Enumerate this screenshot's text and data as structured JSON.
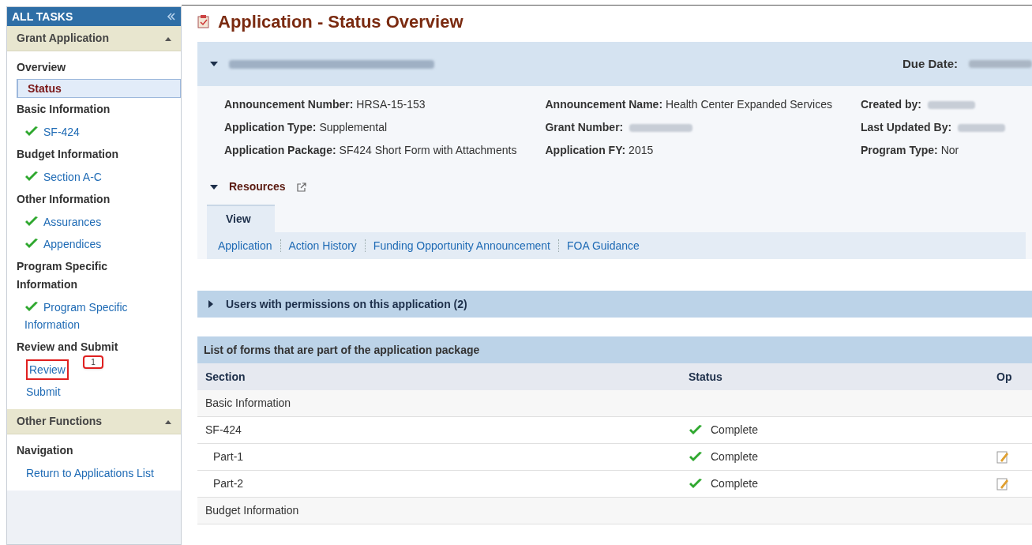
{
  "sidebar": {
    "title": "ALL TASKS",
    "groups": [
      {
        "title": "Grant Application",
        "expanded": true,
        "sections": [
          {
            "title": "Overview",
            "items": [
              {
                "label": "Status",
                "selected": true,
                "checked": false
              }
            ]
          },
          {
            "title": "Basic Information",
            "items": [
              {
                "label": "SF-424",
                "selected": false,
                "checked": true
              }
            ]
          },
          {
            "title": "Budget Information",
            "items": [
              {
                "label": "Section A-C",
                "selected": false,
                "checked": true
              }
            ]
          },
          {
            "title": "Other Information",
            "items": [
              {
                "label": "Assurances",
                "selected": false,
                "checked": true
              },
              {
                "label": "Appendices",
                "selected": false,
                "checked": true
              }
            ]
          },
          {
            "title": "Program Specific Information",
            "items": [
              {
                "label": "Program Specific Information",
                "selected": false,
                "checked": true
              }
            ]
          },
          {
            "title": "Review and Submit",
            "items": [
              {
                "label": "Review",
                "selected": false,
                "checked": false,
                "callout": "1"
              },
              {
                "label": "Submit",
                "selected": false,
                "checked": false
              }
            ]
          }
        ]
      },
      {
        "title": "Other Functions",
        "expanded": true,
        "sections": [
          {
            "title": "Navigation",
            "items": [
              {
                "label": "Return to Applications List",
                "selected": false,
                "checked": false
              }
            ]
          }
        ]
      }
    ]
  },
  "page": {
    "title": "Application - Status Overview",
    "banner": {
      "due_label": "Due Date:"
    },
    "details": [
      [
        {
          "label": "Announcement Number:",
          "value": "HRSA-15-153"
        },
        {
          "label": "Application Type:",
          "value": "Supplemental"
        },
        {
          "label": "Application Package:",
          "value": "SF424 Short Form with Attachments"
        }
      ],
      [
        {
          "label": "Announcement Name:",
          "value": "Health Center Expanded Services"
        },
        {
          "label": "Grant Number:"
        },
        {
          "label": "Application FY:",
          "value": "2015"
        }
      ],
      [
        {
          "label": "Created by:"
        },
        {
          "label": "Last Updated By:"
        },
        {
          "label": "Program Type:",
          "value": "Nor"
        }
      ]
    ],
    "resources": {
      "title": "Resources",
      "expanded": true,
      "tab": "View",
      "links": [
        "Application",
        "Action History",
        "Funding Opportunity Announcement",
        "FOA Guidance"
      ]
    },
    "users_panel": {
      "title": "Users with permissions on this application (2)",
      "expanded": false
    },
    "forms": {
      "title": "List of forms that are part of the application package",
      "columns": [
        "Section",
        "Status",
        "Op"
      ],
      "rows": [
        {
          "kind": "group",
          "section": "Basic Information",
          "editable": false
        },
        {
          "kind": "form",
          "section": "SF-424",
          "status": "Complete",
          "editable": false
        },
        {
          "kind": "part",
          "section": "Part-1",
          "status": "Complete",
          "editable": true
        },
        {
          "kind": "part",
          "section": "Part-2",
          "status": "Complete",
          "editable": true
        },
        {
          "kind": "group",
          "section": "Budget Information",
          "editable": false
        }
      ]
    }
  }
}
